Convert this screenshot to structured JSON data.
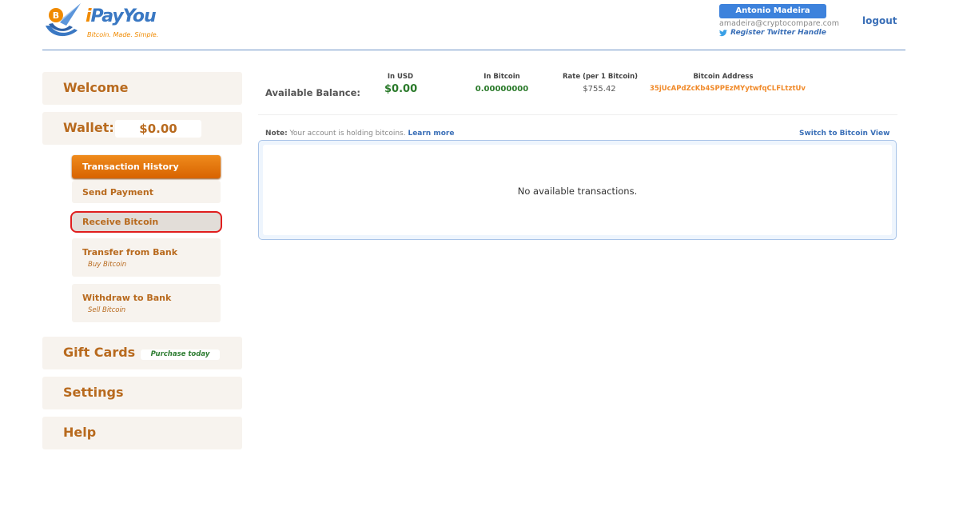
{
  "brand": {
    "name_prefix": "i",
    "name_rest": "PayYou",
    "tagline": "Bitcoin. Made. Simple."
  },
  "user": {
    "name": "Antonio Madeira",
    "email": "amadeira@cryptocompare.com",
    "twitter_link": "Register Twitter Handle",
    "logout": "logout"
  },
  "sidebar": {
    "welcome": "Welcome",
    "wallet": {
      "label": "Wallet:",
      "amount": "$0.00"
    },
    "wallet_items": [
      {
        "label": "Transaction History",
        "hint": ""
      },
      {
        "label": "Send Payment",
        "hint": ""
      },
      {
        "label": "Receive Bitcoin",
        "hint": ""
      },
      {
        "label": "Transfer from Bank",
        "hint": "Buy Bitcoin"
      },
      {
        "label": "Withdraw to Bank",
        "hint": "Sell Bitcoin"
      }
    ],
    "gift_cards": {
      "label": "Gift Cards",
      "badge": "Purchase today"
    },
    "settings": "Settings",
    "help": "Help"
  },
  "balance": {
    "label": "Available Balance:",
    "usd": {
      "header": "In USD",
      "value": "$0.00"
    },
    "btc": {
      "header": "In Bitcoin",
      "value": "0.00000000"
    },
    "rate": {
      "header": "Rate (per 1 Bitcoin)",
      "value": "$755.42"
    },
    "address": {
      "header": "Bitcoin Address",
      "value": "35jUcAPdZcKb4SPPEzMYytwfqCLFLtztUv"
    }
  },
  "note": {
    "prefix": "Note:",
    "text": " Your account is holding bitcoins. ",
    "link": "Learn more"
  },
  "switch_view": "Switch to Bitcoin View",
  "transactions": {
    "empty_message": "No available transactions."
  },
  "colors": {
    "accent_orange": "#b86a1e",
    "active_item": "#e57300",
    "link_blue": "#3a6fb7",
    "money_green": "#2a7a2a",
    "highlight_red": "#e01e1e"
  }
}
